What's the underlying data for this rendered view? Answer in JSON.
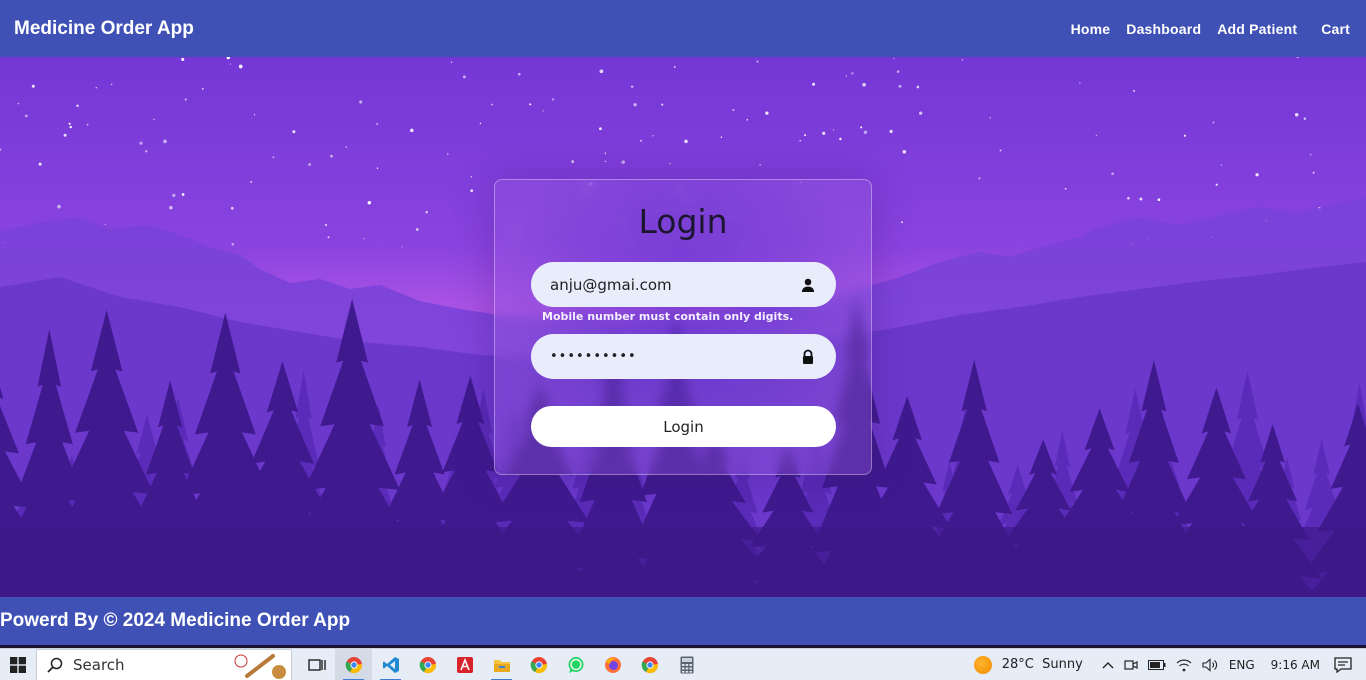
{
  "navbar": {
    "brand": "Medicine Order App",
    "links": [
      "Home",
      "Dashboard",
      "Add Patient",
      "Cart"
    ]
  },
  "login": {
    "title": "Login",
    "email_value": "anju@gmai.com",
    "email_icon": "user-icon",
    "error_message": "Mobile number must contain only digits.",
    "password_value": "••••••••••",
    "password_icon": "lock-icon",
    "button_label": "Login"
  },
  "footer": {
    "text": "Powerd By © 2024 Medicine Order App"
  },
  "taskbar": {
    "search_label": "Search",
    "apps": [
      "chrome-icon",
      "vscode-icon",
      "chrome-icon",
      "acrobat-icon",
      "file-explorer-icon",
      "chrome-icon",
      "whatsapp-icon",
      "firefox-icon",
      "chrome-icon",
      "calculator-icon"
    ],
    "weather": "28°C  Sunny",
    "language": "ENG",
    "time": "9:16 AM"
  },
  "colors": {
    "navbar": "#3f51b5",
    "footer": "#3f51b5",
    "sky_top": "#7a3fd9",
    "sky_glow": "#d96ff0"
  }
}
